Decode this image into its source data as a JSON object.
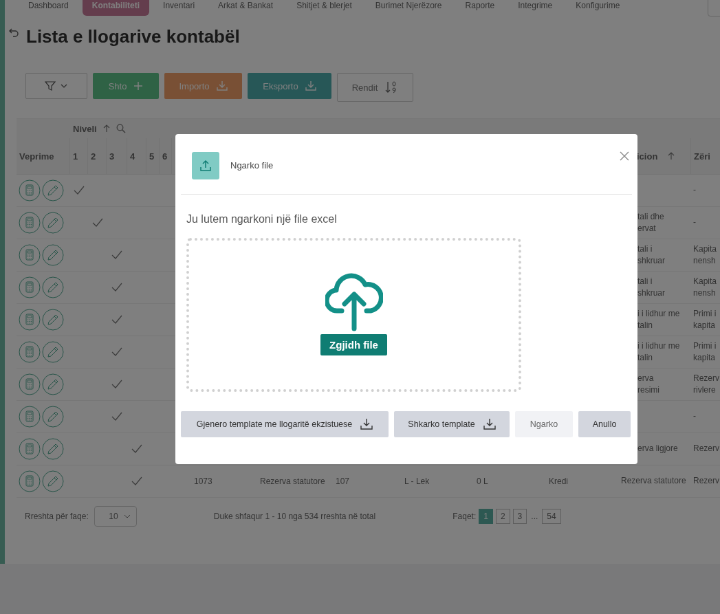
{
  "nav": [
    {
      "label": "Dashboard",
      "selected": false
    },
    {
      "label": "Kontabiliteti",
      "selected": true
    },
    {
      "label": "Inventari",
      "selected": false
    },
    {
      "label": "Arkat & Bankat",
      "selected": false
    },
    {
      "label": "Shitjet & blerjet",
      "selected": false
    },
    {
      "label": "Burimet Njerëzore",
      "selected": false
    },
    {
      "label": "Raporte",
      "selected": false
    },
    {
      "label": "Integrime",
      "selected": false
    },
    {
      "label": "Konfigurime",
      "selected": false
    }
  ],
  "page_title": "Lista e llogarive kontabël",
  "toolbar": [
    {
      "kind": "filter"
    },
    {
      "kind": "add",
      "label": "Shto"
    },
    {
      "kind": "import",
      "label": "Importo"
    },
    {
      "kind": "export",
      "label": "Eksporto"
    },
    {
      "kind": "sort",
      "label": "Rendit"
    }
  ],
  "table": {
    "group_header": "Niveli",
    "columns": {
      "actions": "Veprime",
      "levels": [
        "1",
        "2",
        "3",
        "4",
        "5",
        "6"
      ],
      "position": "icion",
      "zeri": "Zëri"
    },
    "rows": [
      {
        "checks": [
          true,
          false,
          false,
          false,
          false,
          false
        ],
        "position": [],
        "zeri": [
          "-"
        ]
      },
      {
        "checks": [
          false,
          true,
          false,
          false,
          false,
          false
        ],
        "position": [
          "tali dhe",
          "ervat"
        ],
        "zeri": [
          "-"
        ]
      },
      {
        "checks": [
          false,
          false,
          true,
          false,
          false,
          false
        ],
        "position": [
          "tali i",
          "shkruar"
        ],
        "zeri": [
          "Kapita",
          "nensh"
        ]
      },
      {
        "checks": [
          false,
          false,
          true,
          false,
          false,
          false
        ],
        "position": [
          "tali i",
          "shkruar"
        ],
        "zeri": [
          "Kapita",
          "nensh"
        ]
      },
      {
        "checks": [
          false,
          false,
          true,
          false,
          false,
          false
        ],
        "position": [
          "i i lidhur me",
          "talin"
        ],
        "zeri": [
          "Primi i",
          "kapita"
        ]
      },
      {
        "checks": [
          false,
          false,
          true,
          false,
          false,
          false
        ],
        "position": [
          "i i lidhur me",
          "talin"
        ],
        "zeri": [
          "Primi i",
          "kapita"
        ]
      },
      {
        "checks": [
          false,
          false,
          true,
          false,
          false,
          false
        ],
        "position": [
          "erva",
          "resimi"
        ],
        "zeri": [
          "Rezerv",
          "rivlere"
        ]
      },
      {
        "checks": [
          false,
          false,
          true,
          false,
          false,
          false
        ],
        "position": [],
        "zeri": [
          "-"
        ]
      },
      {
        "checks": [
          false,
          false,
          false,
          true,
          false,
          false
        ],
        "position": [
          "erva ligjore"
        ],
        "zeri": [
          "Rezerv"
        ]
      },
      {
        "checks": [
          false,
          false,
          false,
          true,
          false,
          false
        ],
        "cells": [
          "1073",
          "Rezerva statutore",
          "107",
          "L - Lek",
          "0 L",
          "Kredi"
        ],
        "position": [
          "Rezerva statutore"
        ],
        "zeri": [
          "Rezerv"
        ]
      }
    ]
  },
  "footer": {
    "rows_label": "Rreshta për faqe:",
    "rows_value": "10",
    "summary": "Duke shfaqur 1 - 10 nga 534 rreshta në total",
    "pages_label": "Faqet:",
    "pages": [
      {
        "label": "1",
        "selected": true
      },
      {
        "label": "2",
        "selected": false
      },
      {
        "label": "3",
        "selected": false
      },
      {
        "label": "...",
        "selected": false
      },
      {
        "label": "54",
        "selected": false
      }
    ]
  },
  "modal": {
    "title": "Ngarko file",
    "prompt": "Ju lutem ngarkoni një file excel",
    "choose_button": "Zgjidh file",
    "buttons": [
      {
        "label": "Gjenero template me llogaritë ekzistuese",
        "kind": "download",
        "disabled": false
      },
      {
        "label": "Shkarko template",
        "kind": "download",
        "disabled": false
      },
      {
        "label": "Ngarko",
        "kind": "plain",
        "disabled": true
      },
      {
        "label": "Anullo",
        "kind": "plain",
        "disabled": false
      }
    ]
  }
}
